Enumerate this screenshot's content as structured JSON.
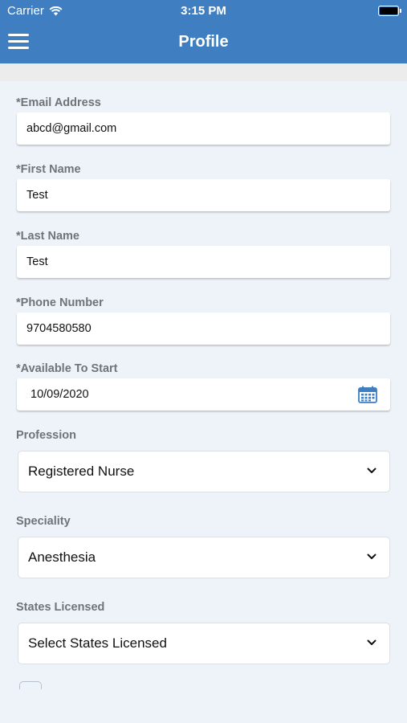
{
  "status_bar": {
    "carrier": "Carrier",
    "time": "3:15 PM"
  },
  "nav": {
    "title": "Profile",
    "menu_icon": "hamburger-menu-icon"
  },
  "form": {
    "email": {
      "label": "*Email Address",
      "value": "abcd@gmail.com"
    },
    "first_name": {
      "label": "*First Name",
      "value": "Test"
    },
    "last_name": {
      "label": "*Last Name",
      "value": "Test"
    },
    "phone": {
      "label": "*Phone Number",
      "value": "9704580580"
    },
    "available": {
      "label": "*Available To Start",
      "value": "10/09/2020",
      "icon": "calendar-icon"
    },
    "profession": {
      "label": "Profession",
      "value": "Registered Nurse"
    },
    "speciality": {
      "label": "Speciality",
      "value": "Anesthesia"
    },
    "states": {
      "label": "States Licensed",
      "value": "Select States Licensed"
    }
  },
  "colors": {
    "header": "#3f7ec1",
    "background": "#eef3f9",
    "label": "#6f7478",
    "calendar": "#3f7ec1"
  }
}
